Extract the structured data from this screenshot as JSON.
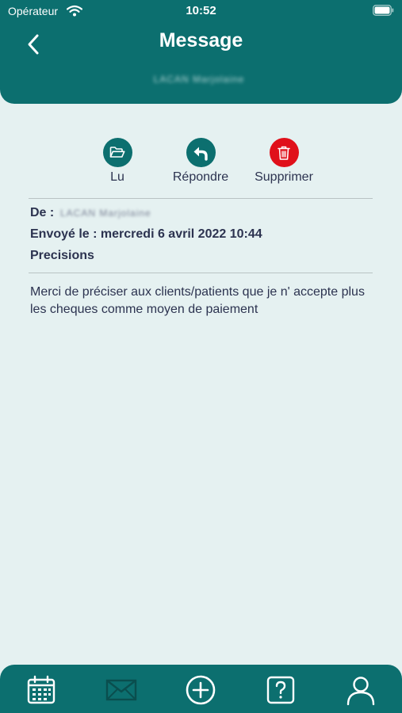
{
  "status_bar": {
    "carrier": "Opérateur",
    "time": "10:52"
  },
  "header": {
    "title": "Message",
    "recipient_redacted": "LACAN Marjolaine"
  },
  "actions": [
    {
      "label": "Lu",
      "icon": "folder-open-icon",
      "color": "#0c6f6f"
    },
    {
      "label": "Répondre",
      "icon": "reply-icon",
      "color": "#0c6f6f"
    },
    {
      "label": "Supprimer",
      "icon": "trash-icon",
      "color": "#e0101a"
    }
  ],
  "message": {
    "from_label": "De :",
    "from_redacted": "LACAN Marjolaine",
    "sent_line": "Envoyé le : mercredi 6 avril 2022 10:44",
    "subject": "Precisions",
    "body": "Merci de préciser aux clients/patients que je n' accepte plus les cheques comme moyen de paiement"
  },
  "tabbar": {
    "items": [
      {
        "icon": "calendar-icon",
        "active": false
      },
      {
        "icon": "mail-icon",
        "active": true
      },
      {
        "icon": "add-circle-icon",
        "active": false
      },
      {
        "icon": "help-icon",
        "active": false
      },
      {
        "icon": "profile-icon",
        "active": false
      }
    ]
  },
  "colors": {
    "primary": "#0c6f6f",
    "background": "#e5f1f1",
    "danger": "#e0101a",
    "text": "#2c3350"
  }
}
